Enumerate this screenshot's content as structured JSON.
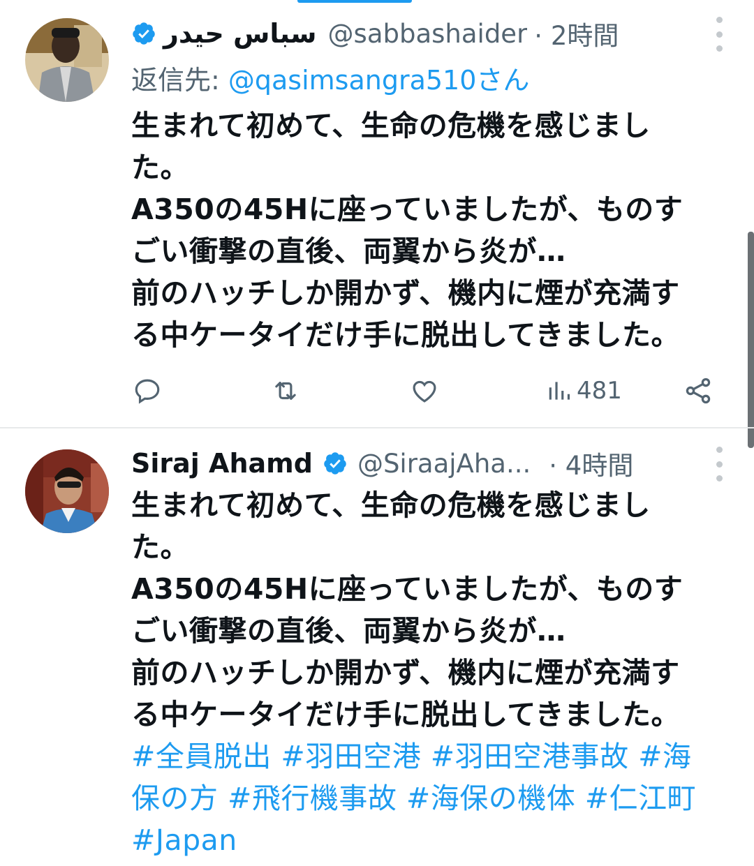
{
  "tweets": [
    {
      "name": "سباس حيدر",
      "handle": "@sabbashaider",
      "time": "· 2時間",
      "reply_prefix": "返信先: ",
      "reply_mention": "@qasimsangra510さん",
      "body_lines": [
        "生まれて初めて、生命の危機を感じまし",
        "た。",
        "A350の45Hに座っていましたが、ものす",
        "ごい衝撃の直後、両翼から炎が…",
        "前のハッチしか開かず、機内に煙が充満す",
        "る中ケータイだけ手に脱出してきました。"
      ],
      "actions": {
        "reply_icon": "reply-icon",
        "retweet_icon": "retweet-icon",
        "like_icon": "heart-icon",
        "views_icon": "views-icon",
        "views_count": "481",
        "share_icon": "share-icon"
      }
    },
    {
      "name": "Siraj Ahamd",
      "handle": "@SiraajAha...",
      "time": "· 4時間",
      "body_lines": [
        "生まれて初めて、生命の危機を感じまし",
        "た。",
        "A350の45Hに座っていましたが、ものす",
        "ごい衝撃の直後、両翼から炎が…",
        "前のハッチしか開かず、機内に煙が充満す",
        "る中ケータイだけ手に脱出してきました。"
      ],
      "hashtag_lines": [
        "#全員脱出 #羽田空港 #羽田空港事故 #海",
        "保の方 #飛行機事故 #海保の機体 #仁江町",
        "#Japan"
      ]
    }
  ],
  "colors": {
    "accent": "#1d9bf0",
    "secondary_text": "#536471",
    "primary_text": "#0f1419",
    "divider": "#e7e9ea"
  }
}
